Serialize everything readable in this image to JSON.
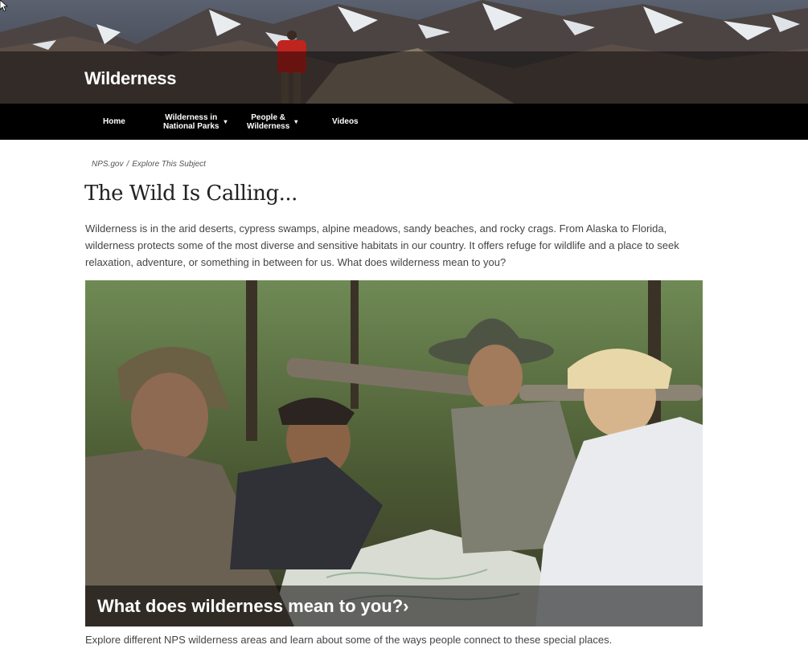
{
  "site": {
    "title": "Wilderness"
  },
  "nav": {
    "items": [
      {
        "label": "Home",
        "has_dropdown": false
      },
      {
        "label": "Wilderness in\nNational Parks",
        "has_dropdown": true
      },
      {
        "label": "People &\nWilderness",
        "has_dropdown": true
      },
      {
        "label": "Videos",
        "has_dropdown": false
      }
    ],
    "caret": "▾"
  },
  "breadcrumb": {
    "items": [
      "NPS.gov",
      "Explore This Subject"
    ],
    "separator": "/"
  },
  "main": {
    "title": "The Wild Is Calling...",
    "intro": "Wilderness is in the arid deserts, cypress swamps, alpine meadows, sandy beaches, and rocky crags. From Alaska to Florida, wilderness protects some of the most diverse and sensitive habitats in our country. It offers refuge for wildlife and a place to seek relaxation, adventure, or something in between for us. What does wilderness mean to you?",
    "feature": {
      "link_text": "What does wilderness mean to you?›",
      "description": "Explore different NPS wilderness areas and learn about some of the ways people connect to these special places."
    }
  },
  "colors": {
    "nav_bg": "#000000",
    "text": "#444444",
    "heading": "#222222"
  }
}
